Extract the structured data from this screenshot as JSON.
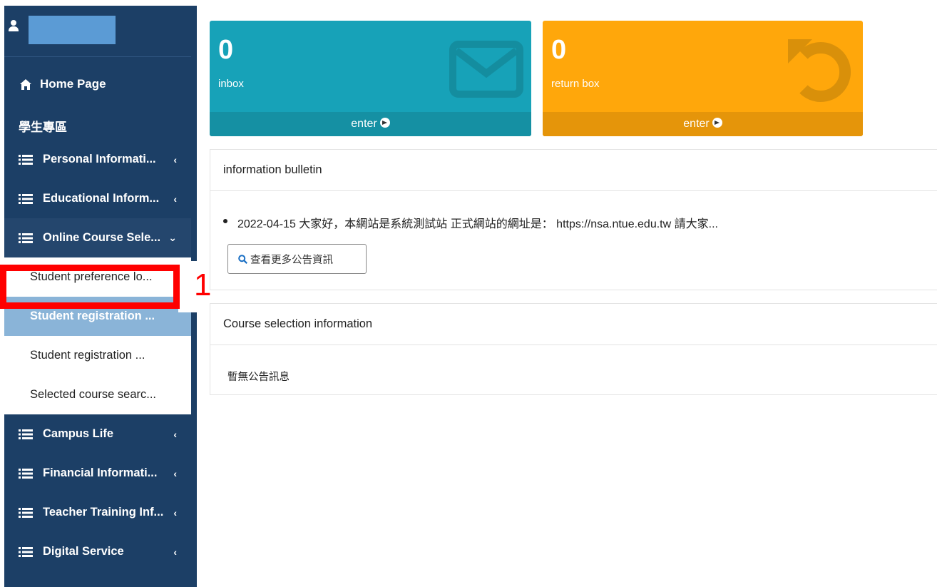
{
  "sidebar": {
    "home_label": "Home Page",
    "section_title": "學生專區",
    "menu": [
      {
        "label": "Personal Informati...",
        "chevron": "‹"
      },
      {
        "label": "Educational Inform...",
        "chevron": "‹"
      },
      {
        "label": "Online Course Sele...",
        "chevron": "⌄"
      }
    ],
    "submenu": [
      "Student preference lo...",
      "Student registration ...",
      "Student registration ...",
      "Selected course searc..."
    ],
    "menu_after": [
      {
        "label": "Campus Life",
        "chevron": "‹"
      },
      {
        "label": "Financial Informati...",
        "chevron": "‹"
      },
      {
        "label": "Teacher Training Inf...",
        "chevron": "‹"
      },
      {
        "label": "Digital Service",
        "chevron": "‹"
      }
    ]
  },
  "annotation": {
    "number": "1"
  },
  "inbox": {
    "count": "0",
    "caption": "inbox",
    "footer": "enter"
  },
  "return_box": {
    "count": "0",
    "caption": "return box",
    "footer": "enter"
  },
  "bulletin": {
    "title": "information bulletin",
    "item": "2022-04-15 大家好，本網站是系統測試站 正式網站的網址是： https://nsa.ntue.edu.tw 請大家...",
    "more_button": "查看更多公告資訊"
  },
  "course_info": {
    "title": "Course selection information",
    "body": "暫無公告訊息"
  },
  "colors": {
    "sidebar": "#1c3f66",
    "inbox": "#17a2b8",
    "return": "#ffa70b",
    "active_sub": "#8ab4d8",
    "highlight": "#ff0000"
  }
}
